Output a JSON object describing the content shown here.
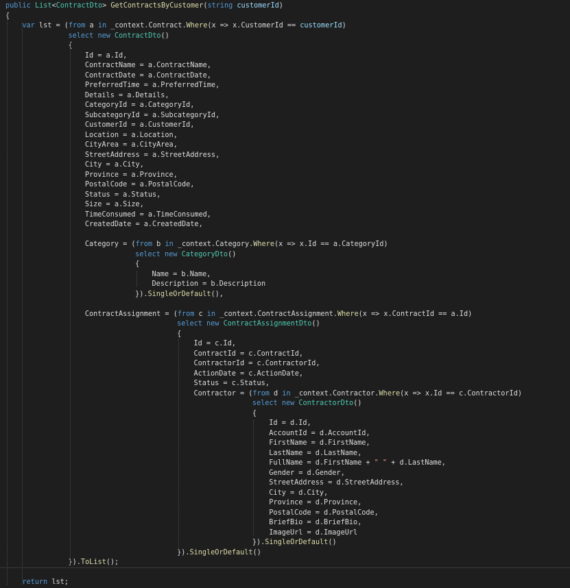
{
  "editor": {
    "language": "C#",
    "theme_colors": {
      "background": "#1e1e1e",
      "default_text": "#dcdcdc",
      "keyword": "#569cd6",
      "type": "#4ec9b0",
      "method": "#dcdcaa",
      "parameter": "#9cdcfe",
      "string": "#d69d85"
    },
    "lines": [
      {
        "indent": 0,
        "tokens": [
          {
            "t": "public",
            "k": "kw"
          },
          {
            "t": " ",
            "k": "tx"
          },
          {
            "t": "List",
            "k": "ty"
          },
          {
            "t": "<",
            "k": "tx"
          },
          {
            "t": "ContractDto",
            "k": "ty"
          },
          {
            "t": "> ",
            "k": "tx"
          },
          {
            "t": "GetContractsByCustomer",
            "k": "mt"
          },
          {
            "t": "(",
            "k": "tx"
          },
          {
            "t": "string",
            "k": "kw"
          },
          {
            "t": " ",
            "k": "tx"
          },
          {
            "t": "customerId",
            "k": "pa"
          },
          {
            "t": ")",
            "k": "tx"
          }
        ]
      },
      {
        "indent": 0,
        "tokens": [
          {
            "t": "{",
            "k": "tx"
          }
        ]
      },
      {
        "indent": 4,
        "tokens": [
          {
            "t": "var",
            "k": "kw"
          },
          {
            "t": " lst = (",
            "k": "tx"
          },
          {
            "t": "from",
            "k": "kw"
          },
          {
            "t": " a ",
            "k": "tx"
          },
          {
            "t": "in",
            "k": "kw"
          },
          {
            "t": " _context.Contract.",
            "k": "tx"
          },
          {
            "t": "Where",
            "k": "mt"
          },
          {
            "t": "(x => x.CustomerId == ",
            "k": "tx"
          },
          {
            "t": "customerId",
            "k": "pa"
          },
          {
            "t": ")",
            "k": "tx"
          }
        ]
      },
      {
        "indent": 15,
        "tokens": [
          {
            "t": "select",
            "k": "kw"
          },
          {
            "t": " ",
            "k": "tx"
          },
          {
            "t": "new",
            "k": "kw"
          },
          {
            "t": " ",
            "k": "tx"
          },
          {
            "t": "ContractDto",
            "k": "ty"
          },
          {
            "t": "()",
            "k": "tx"
          }
        ]
      },
      {
        "indent": 15,
        "tokens": [
          {
            "t": "{",
            "k": "tx"
          }
        ]
      },
      {
        "indent": 19,
        "tokens": [
          {
            "t": "Id = a.Id,",
            "k": "tx"
          }
        ]
      },
      {
        "indent": 19,
        "tokens": [
          {
            "t": "ContractName = a.ContractName,",
            "k": "tx"
          }
        ]
      },
      {
        "indent": 19,
        "tokens": [
          {
            "t": "ContractDate = a.ContractDate,",
            "k": "tx"
          }
        ]
      },
      {
        "indent": 19,
        "tokens": [
          {
            "t": "PreferredTime = a.PreferredTime,",
            "k": "tx"
          }
        ]
      },
      {
        "indent": 19,
        "tokens": [
          {
            "t": "Details = a.Details,",
            "k": "tx"
          }
        ]
      },
      {
        "indent": 19,
        "tokens": [
          {
            "t": "CategoryId = a.CategoryId,",
            "k": "tx"
          }
        ]
      },
      {
        "indent": 19,
        "tokens": [
          {
            "t": "SubcategoryId = a.SubcategoryId,",
            "k": "tx"
          }
        ]
      },
      {
        "indent": 19,
        "tokens": [
          {
            "t": "CustomerId = a.CustomerId,",
            "k": "tx"
          }
        ]
      },
      {
        "indent": 19,
        "tokens": [
          {
            "t": "Location = a.Location,",
            "k": "tx"
          }
        ]
      },
      {
        "indent": 19,
        "tokens": [
          {
            "t": "CityArea = a.CityArea,",
            "k": "tx"
          }
        ]
      },
      {
        "indent": 19,
        "tokens": [
          {
            "t": "StreetAddress = a.StreetAddress,",
            "k": "tx"
          }
        ]
      },
      {
        "indent": 19,
        "tokens": [
          {
            "t": "City = a.City,",
            "k": "tx"
          }
        ]
      },
      {
        "indent": 19,
        "tokens": [
          {
            "t": "Province = a.Province,",
            "k": "tx"
          }
        ]
      },
      {
        "indent": 19,
        "tokens": [
          {
            "t": "PostalCode = a.PostalCode,",
            "k": "tx"
          }
        ]
      },
      {
        "indent": 19,
        "tokens": [
          {
            "t": "Status = a.Status,",
            "k": "tx"
          }
        ]
      },
      {
        "indent": 19,
        "tokens": [
          {
            "t": "Size = a.Size,",
            "k": "tx"
          }
        ]
      },
      {
        "indent": 19,
        "tokens": [
          {
            "t": "TimeConsumed = a.TimeConsumed,",
            "k": "tx"
          }
        ]
      },
      {
        "indent": 19,
        "tokens": [
          {
            "t": "CreatedDate = a.CreatedDate,",
            "k": "tx"
          }
        ]
      },
      {
        "indent": 0,
        "tokens": []
      },
      {
        "indent": 19,
        "tokens": [
          {
            "t": "Category = (",
            "k": "tx"
          },
          {
            "t": "from",
            "k": "kw"
          },
          {
            "t": " b ",
            "k": "tx"
          },
          {
            "t": "in",
            "k": "kw"
          },
          {
            "t": " _context.Category.",
            "k": "tx"
          },
          {
            "t": "Where",
            "k": "mt"
          },
          {
            "t": "(x => x.Id == a.CategoryId)",
            "k": "tx"
          }
        ]
      },
      {
        "indent": 31,
        "tokens": [
          {
            "t": "select",
            "k": "kw"
          },
          {
            "t": " ",
            "k": "tx"
          },
          {
            "t": "new",
            "k": "kw"
          },
          {
            "t": " ",
            "k": "tx"
          },
          {
            "t": "CategoryDto",
            "k": "ty"
          },
          {
            "t": "()",
            "k": "tx"
          }
        ]
      },
      {
        "indent": 31,
        "tokens": [
          {
            "t": "{",
            "k": "tx"
          }
        ]
      },
      {
        "indent": 35,
        "tokens": [
          {
            "t": "Name = b.Name,",
            "k": "tx"
          }
        ]
      },
      {
        "indent": 35,
        "tokens": [
          {
            "t": "Description = b.Description",
            "k": "tx"
          }
        ]
      },
      {
        "indent": 31,
        "tokens": [
          {
            "t": "}).",
            "k": "tx"
          },
          {
            "t": "SingleOrDefault",
            "k": "mt"
          },
          {
            "t": "(),",
            "k": "tx"
          }
        ]
      },
      {
        "indent": 0,
        "tokens": []
      },
      {
        "indent": 19,
        "tokens": [
          {
            "t": "ContractAssignment = (",
            "k": "tx"
          },
          {
            "t": "from",
            "k": "kw"
          },
          {
            "t": " c ",
            "k": "tx"
          },
          {
            "t": "in",
            "k": "kw"
          },
          {
            "t": " _context.ContractAssignment.",
            "k": "tx"
          },
          {
            "t": "Where",
            "k": "mt"
          },
          {
            "t": "(x => x.ContractId == a.Id)",
            "k": "tx"
          }
        ]
      },
      {
        "indent": 41,
        "tokens": [
          {
            "t": "select",
            "k": "kw"
          },
          {
            "t": " ",
            "k": "tx"
          },
          {
            "t": "new",
            "k": "kw"
          },
          {
            "t": " ",
            "k": "tx"
          },
          {
            "t": "ContractAssignmentDto",
            "k": "ty"
          },
          {
            "t": "()",
            "k": "tx"
          }
        ]
      },
      {
        "indent": 41,
        "tokens": [
          {
            "t": "{",
            "k": "tx"
          }
        ]
      },
      {
        "indent": 45,
        "tokens": [
          {
            "t": "Id = c.Id,",
            "k": "tx"
          }
        ]
      },
      {
        "indent": 45,
        "tokens": [
          {
            "t": "ContractId = c.ContractId,",
            "k": "tx"
          }
        ]
      },
      {
        "indent": 45,
        "tokens": [
          {
            "t": "ContractorId = c.ContractorId,",
            "k": "tx"
          }
        ]
      },
      {
        "indent": 45,
        "tokens": [
          {
            "t": "ActionDate = c.ActionDate,",
            "k": "tx"
          }
        ]
      },
      {
        "indent": 45,
        "tokens": [
          {
            "t": "Status = c.Status,",
            "k": "tx"
          }
        ]
      },
      {
        "indent": 45,
        "tokens": [
          {
            "t": "Contractor = (",
            "k": "tx"
          },
          {
            "t": "from",
            "k": "kw"
          },
          {
            "t": " d ",
            "k": "tx"
          },
          {
            "t": "in",
            "k": "kw"
          },
          {
            "t": " _context.Contractor.",
            "k": "tx"
          },
          {
            "t": "Where",
            "k": "mt"
          },
          {
            "t": "(x => x.Id == c.ContractorId)",
            "k": "tx"
          }
        ]
      },
      {
        "indent": 59,
        "tokens": [
          {
            "t": "select",
            "k": "kw"
          },
          {
            "t": " ",
            "k": "tx"
          },
          {
            "t": "new",
            "k": "kw"
          },
          {
            "t": " ",
            "k": "tx"
          },
          {
            "t": "ContractorDto",
            "k": "ty"
          },
          {
            "t": "()",
            "k": "tx"
          }
        ]
      },
      {
        "indent": 59,
        "tokens": [
          {
            "t": "{",
            "k": "tx"
          }
        ]
      },
      {
        "indent": 63,
        "tokens": [
          {
            "t": "Id = d.Id,",
            "k": "tx"
          }
        ]
      },
      {
        "indent": 63,
        "tokens": [
          {
            "t": "AccountId = d.AccountId,",
            "k": "tx"
          }
        ]
      },
      {
        "indent": 63,
        "tokens": [
          {
            "t": "FirstName = d.FirstName,",
            "k": "tx"
          }
        ]
      },
      {
        "indent": 63,
        "tokens": [
          {
            "t": "LastName = d.LastName,",
            "k": "tx"
          }
        ]
      },
      {
        "indent": 63,
        "tokens": [
          {
            "t": "FullName = d.FirstName + ",
            "k": "tx"
          },
          {
            "t": "\" \"",
            "k": "st"
          },
          {
            "t": " + d.LastName,",
            "k": "tx"
          }
        ]
      },
      {
        "indent": 63,
        "tokens": [
          {
            "t": "Gender = d.Gender,",
            "k": "tx"
          }
        ]
      },
      {
        "indent": 63,
        "tokens": [
          {
            "t": "StreetAddress = d.StreetAddress,",
            "k": "tx"
          }
        ]
      },
      {
        "indent": 63,
        "tokens": [
          {
            "t": "City = d.City,",
            "k": "tx"
          }
        ]
      },
      {
        "indent": 63,
        "tokens": [
          {
            "t": "Province = d.Province,",
            "k": "tx"
          }
        ]
      },
      {
        "indent": 63,
        "tokens": [
          {
            "t": "PostalCode = d.PostalCode,",
            "k": "tx"
          }
        ]
      },
      {
        "indent": 63,
        "tokens": [
          {
            "t": "BriefBio = d.BriefBio,",
            "k": "tx"
          }
        ]
      },
      {
        "indent": 63,
        "tokens": [
          {
            "t": "ImageUrl = d.ImageUrl",
            "k": "tx"
          }
        ]
      },
      {
        "indent": 59,
        "tokens": [
          {
            "t": "}).",
            "k": "tx"
          },
          {
            "t": "SingleOrDefault",
            "k": "mt"
          },
          {
            "t": "()",
            "k": "tx"
          }
        ]
      },
      {
        "indent": 41,
        "tokens": [
          {
            "t": "}).",
            "k": "tx"
          },
          {
            "t": "SingleOrDefault",
            "k": "mt"
          },
          {
            "t": "()",
            "k": "tx"
          }
        ]
      },
      {
        "indent": 15,
        "tokens": [
          {
            "t": "}).",
            "k": "tx"
          },
          {
            "t": "ToList",
            "k": "mt"
          },
          {
            "t": "();",
            "k": "tx"
          }
        ]
      },
      {
        "indent": 0,
        "tokens": []
      },
      {
        "indent": 4,
        "tokens": [
          {
            "t": "return",
            "k": "kw"
          },
          {
            "t": " lst;",
            "k": "tx"
          }
        ]
      }
    ]
  }
}
